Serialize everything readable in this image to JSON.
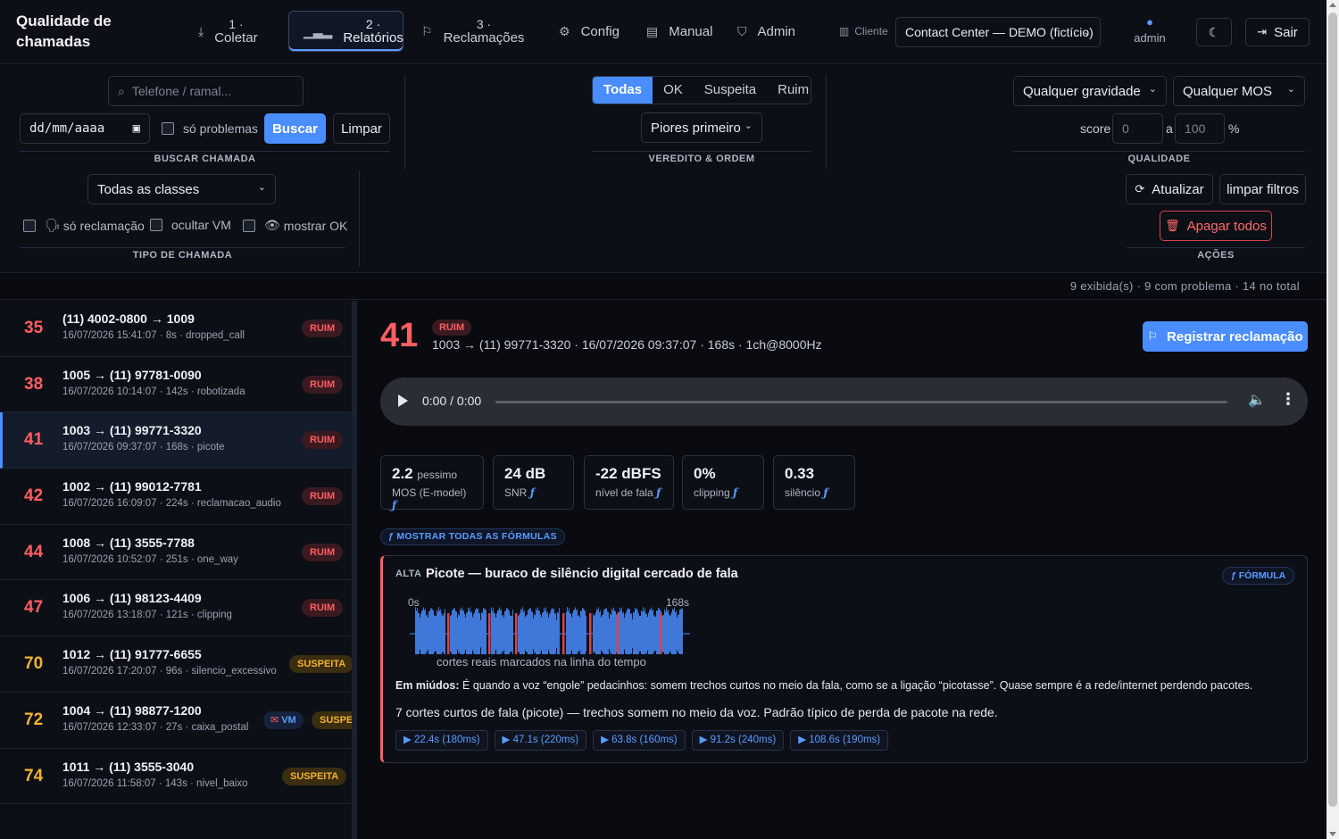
{
  "app": {
    "title_line1": "Qualidade de",
    "title_line2": "chamadas"
  },
  "nav": {
    "coletar": {
      "num": "1 ·",
      "label": "Coletar",
      "icon": "download-icon"
    },
    "relatorios": {
      "num": "2 ·",
      "label": "Relatórios",
      "icon": "bar-chart-icon"
    },
    "reclamacoes": {
      "num": "3 ·",
      "label": "Reclamações",
      "icon": "flag-icon"
    },
    "config": {
      "label": "Config",
      "icon": "sliders-icon"
    },
    "manual": {
      "label": "Manual",
      "icon": "book-icon"
    },
    "admin": {
      "label": "Admin",
      "icon": "shield-icon"
    },
    "cliente_label": "Cliente",
    "cliente_value": "Contact Center — DEMO (fictício)",
    "user": "admin"
  },
  "filters": {
    "phone_placeholder": "Telefone / ramal...",
    "date_placeholder": "dd/mm/aaaa",
    "only_problems": "só problemas",
    "buscar": "Buscar",
    "limpar": "Limpar",
    "buscar_label": "BUSCAR CHAMADA",
    "verdict": [
      "Todas",
      "OK",
      "Suspeita",
      "Ruim"
    ],
    "order": "Piores primeiro",
    "verdict_label": "VEREDITO & ORDEM",
    "gravity": "Qualquer gravidade",
    "mos": "Qualquer MOS",
    "score_label": "score",
    "score_min": "0",
    "score_to": "a",
    "score_max": "100",
    "pct": "%",
    "quality_label": "QUALIDADE",
    "classes": "Todas as classes",
    "only_complaint": "só reclamação",
    "hide_vm": "ocultar VM",
    "show_ok": "mostrar OK",
    "type_label": "TIPO DE CHAMADA",
    "atualizar": "Atualizar",
    "limpar_filtros": "limpar filtros",
    "apagar": "Apagar todos",
    "actions_label": "AÇÕES"
  },
  "status": "9 exibida(s) · 9 com problema · 14 no total",
  "calls": [
    {
      "id": "35",
      "route": "(11) 4002-0800 → 1009",
      "meta": "16/07/2026 15:41:07 · 8s · dropped_call",
      "badge": "RUIM"
    },
    {
      "id": "38",
      "route": "1005 → (11) 97781-0090",
      "meta": "16/07/2026 10:14:07 · 142s · robotizada",
      "badge": "RUIM"
    },
    {
      "id": "41",
      "route": "1003 → (11) 99771-3320",
      "meta": "16/07/2026 09:37:07 · 168s · picote",
      "badge": "RUIM"
    },
    {
      "id": "42",
      "route": "1002 → (11) 99012-7781",
      "meta": "16/07/2026 16:09:07 · 224s · reclamacao_audio",
      "badge": "RUIM"
    },
    {
      "id": "44",
      "route": "1008 → (11) 3555-7788",
      "meta": "16/07/2026 10:52:07 · 251s · one_way",
      "badge": "RUIM"
    },
    {
      "id": "47",
      "route": "1006 → (11) 98123-4409",
      "meta": "16/07/2026 13:18:07 · 121s · clipping",
      "badge": "RUIM"
    },
    {
      "id": "70",
      "route": "1012 → (11) 91777-6655",
      "meta": "16/07/2026 17:20:07 · 96s · silencio_excessivo",
      "badge": "SUSPEITA"
    },
    {
      "id": "72",
      "route": "1004 → (11) 98877-1200",
      "meta": "16/07/2026 12:33:07 · 27s · caixa_postal",
      "badge": "SUSPEITA",
      "vm": "VM"
    },
    {
      "id": "74",
      "route": "1011 → (11) 3555-3040",
      "meta": "16/07/2026 11:58:07 · 143s · nivel_baixo",
      "badge": "SUSPEITA"
    }
  ],
  "detail": {
    "id": "41",
    "badge": "RUIM",
    "meta": "1003 → (11) 99771-3320 · 16/07/2026 09:37:07 · 168s · 1ch@8000Hz",
    "register": "Registrar reclamação",
    "audio_time": "0:00 / 0:00",
    "metrics": [
      {
        "value": "2.2",
        "extra": "pessimo",
        "label": "MOS (E-model)"
      },
      {
        "value": "24 dB",
        "label": "SNR"
      },
      {
        "value": "-22 dBFS",
        "label": "nível de fala"
      },
      {
        "value": "0%",
        "label": "clipping"
      },
      {
        "value": "0.33",
        "label": "silêncio"
      }
    ],
    "formula_glyph": "ƒ",
    "show_formulas": "ƒ MOSTRAR TODAS AS FÓRMULAS",
    "card": {
      "severity": "ALTA",
      "title": "Picote — buraco de silêncio digital cercado de fala",
      "formula_btn": "ƒ FÓRMULA",
      "wave_start": "0s",
      "wave_end": "168s",
      "caption": "cortes reais marcados na linha do tempo",
      "plain_label": "Em miúdos:",
      "plain_text": "É quando a voz “engole” pedacinhos: somem trechos curtos no meio da fala, como se a ligação “picotasse”. Quase sempre é a rede/internet perdendo pacotes.",
      "description": "7 cortes curtos de fala (picote) — trechos somem no meio da voz. Padrão típico de perda de pacote na rede.",
      "cuts": [
        "▶ 22.4s (180ms)",
        "▶ 47.1s (220ms)",
        "▶ 63.8s (160ms)",
        "▶ 91.2s (240ms)",
        "▶ 108.6s (190ms)"
      ]
    }
  },
  "colors": {
    "accent": "#4a8dff",
    "bad": "#ff5e63",
    "warn": "#f2b233",
    "bg": "#090b10"
  }
}
